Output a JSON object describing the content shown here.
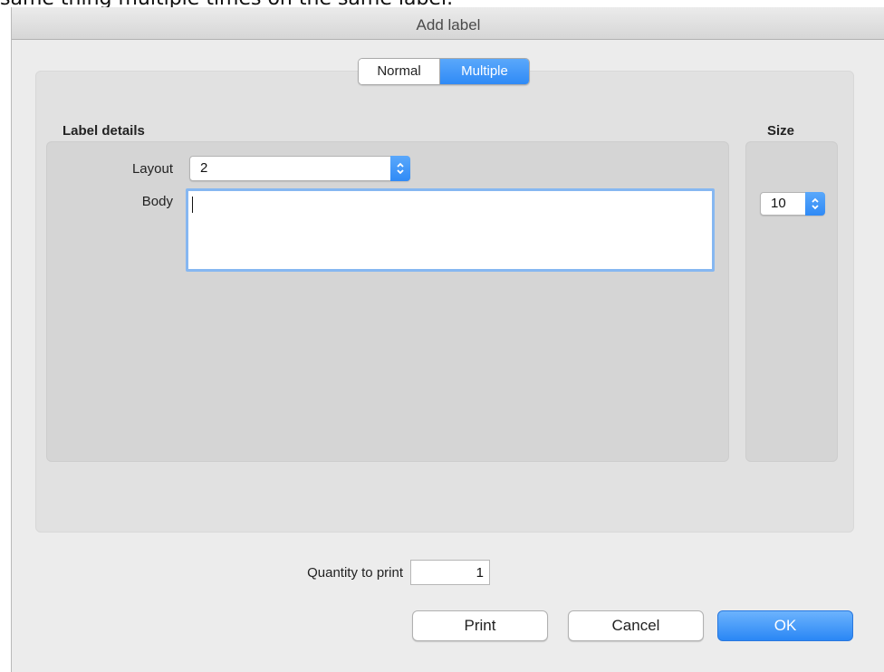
{
  "page": {
    "caption": "same thing multiple times on the same label."
  },
  "dialog": {
    "title": "Add label"
  },
  "tabs": [
    {
      "label": "Normal",
      "selected": false
    },
    {
      "label": "Multiple",
      "selected": true
    }
  ],
  "label_details": {
    "heading": "Label details",
    "layout_label": "Layout",
    "layout_value": "2",
    "body_label": "Body",
    "body_value": ""
  },
  "size": {
    "heading": "Size",
    "value": "10"
  },
  "quantity": {
    "label": "Quantity to print",
    "value": "1"
  },
  "buttons": {
    "print": "Print",
    "cancel": "Cancel",
    "ok": "OK"
  },
  "colors": {
    "accent": "#2f8af6",
    "focus_ring": "#86b7f1",
    "panel": "#d5d5d5"
  }
}
